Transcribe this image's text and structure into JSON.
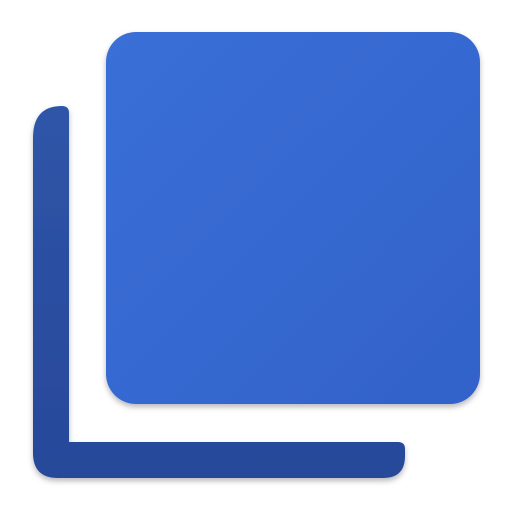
{
  "icon": {
    "name": "layers-icon",
    "colors": {
      "back_layer": "#2f55a8",
      "back_layer_shade": "#27489a",
      "front_layer_light": "#3a6fd8",
      "front_layer_dark": "#3262c9",
      "background": "#ffffff"
    }
  }
}
